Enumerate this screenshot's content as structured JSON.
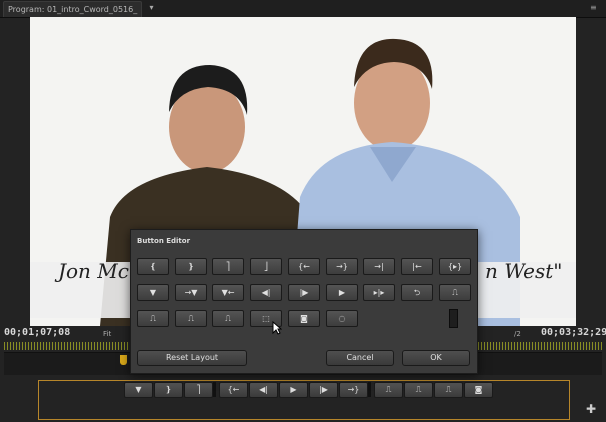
{
  "tab": {
    "label": "Program: 01_intro_Cword_0516_"
  },
  "video": {
    "lower_third_left": "Jon Mc",
    "lower_third_right": "n West\""
  },
  "timecodes": {
    "current": "00;01;07;08",
    "duration": "00;03;32;29"
  },
  "view": {
    "fit": "Fit",
    "resolution": "/2"
  },
  "dialog": {
    "title": "Button Editor",
    "reset_layout": "Reset Layout",
    "cancel": "Cancel",
    "ok": "OK",
    "rows": [
      [
        "add-marker-icon",
        "mark-in-icon",
        "mark-out-icon",
        "mark-clip-icon",
        "go-to-in-icon",
        "go-to-out-icon",
        "go-to-next-edit-icon",
        "go-to-prev-edit-icon",
        "play-in-to-out-icon"
      ],
      [
        "marker-icon",
        "go-to-next-marker-icon",
        "go-to-prev-marker-icon",
        "step-back-icon",
        "step-forward-icon",
        "play-icon",
        "play-around-icon",
        "loop-icon",
        "insert-icon"
      ],
      [
        "overwrite-icon",
        "lift-icon",
        "extract-icon",
        "trim-monitor-icon",
        "export-frame-icon",
        "closed-caption-icon"
      ]
    ],
    "glyphs": {
      "add-marker-icon": "❴",
      "mark-in-icon": "❵",
      "mark-out-icon": "⎤",
      "mark-clip-icon": "⎦",
      "go-to-in-icon": "{←",
      "go-to-out-icon": "→}",
      "go-to-next-edit-icon": "→|",
      "go-to-prev-edit-icon": "|←",
      "play-in-to-out-icon": "{▸}",
      "marker-icon": "▼",
      "go-to-next-marker-icon": "→▼",
      "go-to-prev-marker-icon": "▼←",
      "step-back-icon": "◀|",
      "step-forward-icon": "|▶",
      "play-icon": "▶",
      "play-around-icon": "▸|▸",
      "loop-icon": "⮌",
      "insert-icon": "⎍",
      "overwrite-icon": "⎍",
      "lift-icon": "⎍",
      "extract-icon": "⎍",
      "trim-monitor-icon": "⬚",
      "export-frame-icon": "◙",
      "closed-caption-icon": "◌"
    }
  },
  "transport": [
    "marker-icon",
    "mark-in-icon",
    "mark-out-icon",
    "|",
    "go-to-in-icon",
    "step-back-icon",
    "play-icon",
    "step-forward-icon",
    "go-to-out-icon",
    "|",
    "insert-icon",
    "overwrite-icon",
    "lift-icon",
    "export-frame-icon"
  ]
}
